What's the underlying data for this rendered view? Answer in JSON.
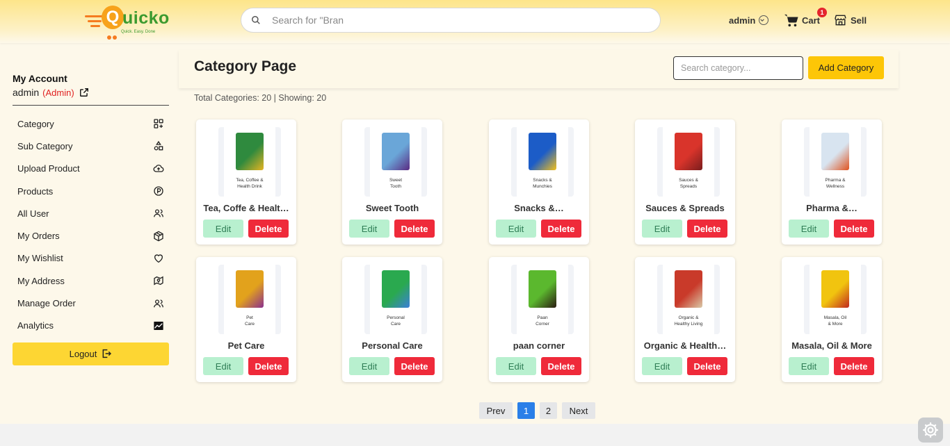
{
  "brand": {
    "name": "uicko",
    "q": "Q",
    "tagline": "Quick. Easy. Done"
  },
  "search": {
    "placeholder": "Search for \"Bran"
  },
  "header": {
    "admin_label": "admin",
    "cart_label": "Cart",
    "cart_count": "1",
    "sell_label": "Sell"
  },
  "account": {
    "title": "My Account",
    "username": "admin",
    "role": "(Admin)"
  },
  "menu": [
    {
      "label": "Category",
      "icon": "category-icon"
    },
    {
      "label": "Sub Category",
      "icon": "shapes-icon"
    },
    {
      "label": "Upload Product",
      "icon": "cloud-upload-icon"
    },
    {
      "label": "Products",
      "icon": "product-p-icon"
    },
    {
      "label": "All User",
      "icon": "users-icon"
    },
    {
      "label": "My Orders",
      "icon": "package-icon"
    },
    {
      "label": "My Wishlist",
      "icon": "heart-icon"
    },
    {
      "label": "My Address",
      "icon": "map-icon"
    },
    {
      "label": "Manage Order",
      "icon": "users-icon"
    },
    {
      "label": "Analytics",
      "icon": "chart-icon"
    }
  ],
  "logout_label": "Logout",
  "page": {
    "title": "Category Page",
    "search_placeholder": "Search category...",
    "add_label": "Add Category",
    "totals": "Total Categories: 20 | Showing: 20"
  },
  "cards": [
    {
      "name": "Tea, Coffe & Healt…",
      "caption1": "Tea, Coffee &",
      "caption2": "Health Drink",
      "color": "#2f8a3e",
      "color2": "#e6b422"
    },
    {
      "name": "Sweet Tooth",
      "caption1": "Sweet",
      "caption2": "Tooth",
      "color": "#6aa6d8",
      "color2": "#5a2a82"
    },
    {
      "name": "Snacks &…",
      "caption1": "Snacks &",
      "caption2": "Munchies",
      "color": "#1c5cc7",
      "color2": "#f3c11b"
    },
    {
      "name": "Sauces & Spreads",
      "caption1": "Sauces &",
      "caption2": "Spreads",
      "color": "#d9342b",
      "color2": "#7a1d1d"
    },
    {
      "name": "Pharma &…",
      "caption1": "Pharma &",
      "caption2": "Wellness",
      "color": "#d8e4f0",
      "color2": "#e0531f"
    },
    {
      "name": "Pet Care",
      "caption1": "Pet",
      "caption2": "Care",
      "color": "#e2a21c",
      "color2": "#8b2f8e"
    },
    {
      "name": "Personal Care",
      "caption1": "Personal",
      "caption2": "Care",
      "color": "#2aa94f",
      "color2": "#3d7fd9"
    },
    {
      "name": "paan corner",
      "caption1": "Paan",
      "caption2": "Corner",
      "color": "#5bb82e",
      "color2": "#2b1b12"
    },
    {
      "name": "Organic & Health…",
      "caption1": "Organic &",
      "caption2": "Healthy Living",
      "color": "#c93a2a",
      "color2": "#d9c9a8"
    },
    {
      "name": "Masala, Oil & More",
      "caption1": "Masala, Oil",
      "caption2": "& More",
      "color": "#f1c40f",
      "color2": "#c0281f"
    }
  ],
  "card_buttons": {
    "edit": "Edit",
    "delete": "Delete"
  },
  "pagination": {
    "prev": "Prev",
    "pages": [
      "1",
      "2"
    ],
    "current": "1",
    "next": "Next"
  }
}
